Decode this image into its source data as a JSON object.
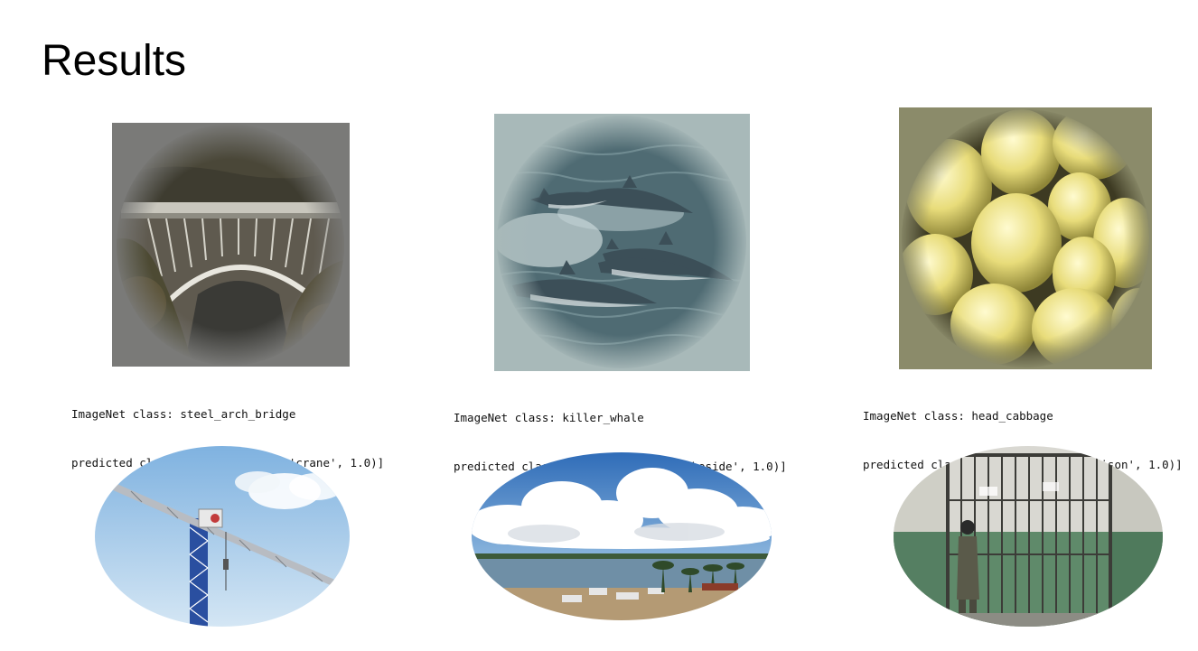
{
  "slide": {
    "title": "Results"
  },
  "results": [
    {
      "imagenet_label": "ImageNet class: steel_arch_bridge",
      "predicted_label": "predicted class: [('n03126707', 'crane', 1.0)]",
      "input_image": "steel-arch-bridge-image",
      "target_image": "crane-image"
    },
    {
      "imagenet_label": "ImageNet class: killer_whale",
      "predicted_label": "predicted class: [('n09332890', 'lakeside', 1.0)]",
      "input_image": "killer-whale-dolphins-image",
      "target_image": "lakeside-image"
    },
    {
      "imagenet_label": "ImageNet class: head_cabbage",
      "predicted_label": "predicted class: [('n04005630', 'prison', 1.0)]",
      "input_image": "lemons-image",
      "target_image": "prison-image"
    }
  ]
}
